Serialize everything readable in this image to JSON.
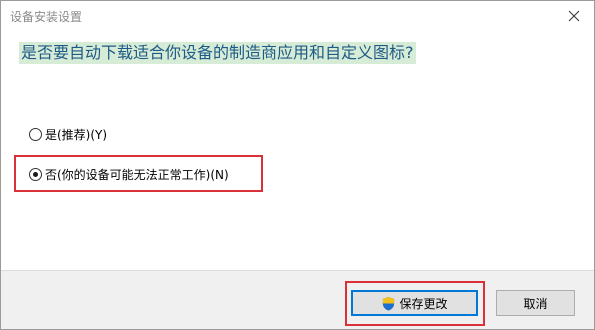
{
  "window": {
    "title": "设备安装设置",
    "close_icon": "close-icon"
  },
  "prompt": {
    "question": "是否要自动下载适合你设备的制造商应用和自定义图标?"
  },
  "options": [
    {
      "label": "是(推荐)(Y)",
      "selected": false
    },
    {
      "label": "否(你的设备可能无法正常工作)(N)",
      "selected": true
    }
  ],
  "buttons": {
    "save_label": "保存更改",
    "save_icon": "shield-icon",
    "cancel_label": "取消"
  },
  "colors": {
    "question_text": "#1e5a87",
    "question_highlight": "#d6ecd6",
    "annotation_red": "#d9303a",
    "primary_border": "#0078d7"
  }
}
